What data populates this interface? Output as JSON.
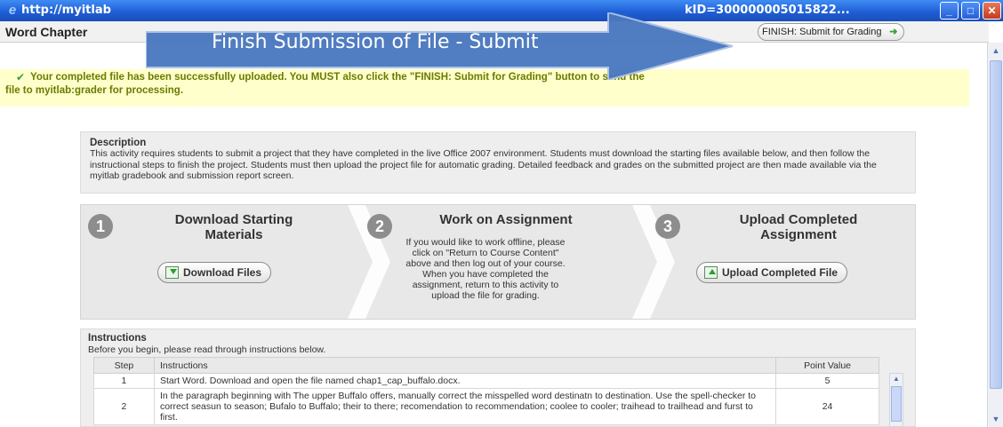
{
  "window": {
    "url_left": "http://myitlab",
    "url_right": "kID=300000005015822...",
    "minimize_label": "_",
    "maximize_label": "□",
    "close_label": "✕"
  },
  "header": {
    "title": "Word Chapter",
    "finish_button_label": "FINISH: Submit for Grading",
    "finish_button_icon": "arrow-right-icon"
  },
  "overlay": {
    "text": "Finish Submission of File - Submit",
    "color": "#4a78c0"
  },
  "notice": {
    "line1": "Your completed file has been successfully uploaded. You MUST also click the \"FINISH: Submit for Grading\" button to send the",
    "line2": "file to myitlab:grader for processing."
  },
  "description": {
    "heading": "Description",
    "body": "This activity requires students to submit a project that they have completed in the live Office 2007 environment. Students must download the starting files available below, and then follow the instructional steps to finish the project. Students must then upload the project file for automatic grading. Detailed feedback and grades on the submitted project are then made available via the myitlab gradebook and submission report screen."
  },
  "steps": [
    {
      "number": "1",
      "title": "Download Starting Materials",
      "button_label": "Download Files"
    },
    {
      "number": "2",
      "title": "Work on Assignment",
      "body": "If you would like to work offline, please click on \"Return to Course Content\" above and then log out of your course. When you have completed the assignment, return to this activity to upload the file for grading."
    },
    {
      "number": "3",
      "title": "Upload Completed Assignment",
      "button_label": "Upload Completed File"
    }
  ],
  "instructions": {
    "heading": "Instructions",
    "subheading": "Before you begin, please read through instructions below.",
    "columns": [
      "Step",
      "Instructions",
      "Point Value"
    ],
    "rows": [
      {
        "step": "1",
        "text": "Start Word. Download and open the file named chap1_cap_buffalo.docx.",
        "points": "5"
      },
      {
        "step": "2",
        "text": "In the paragraph beginning with The upper Buffalo offers, manually correct the misspelled word destinatn to destination. Use the spell-checker to correct seasun to season; Bufalo to Buffalo; their to there; recomendation to recommendation; coolee to cooler; traihead to trailhead and furst to first.",
        "points": "24"
      }
    ]
  }
}
